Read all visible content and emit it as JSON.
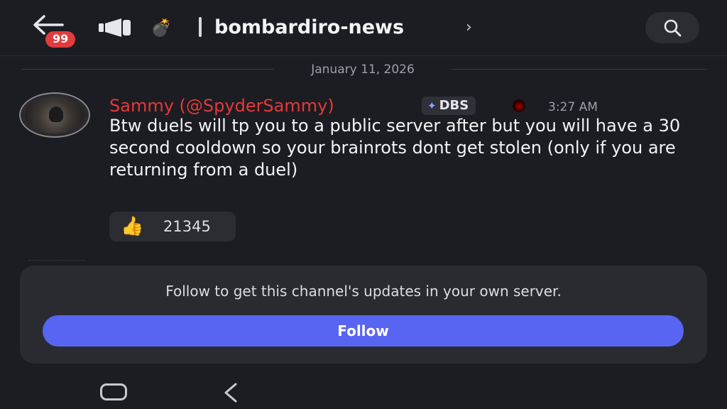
{
  "header": {
    "back_icon": "arrow-left-icon",
    "notification_badge": "99",
    "announcement_icon": "megaphone-icon",
    "channel_emoji": "💣",
    "channel_name": "bombardiro-news",
    "chevron": "›",
    "search_icon": "search-icon"
  },
  "date_divider": "January 11, 2026",
  "message": {
    "author": "Sammy (@SpyderSammy)",
    "author_color": "#e5383b",
    "tag_label": "DBS",
    "tag_icon": "✦",
    "timestamp": "3:27 AM",
    "text": "Btw duels will tp you to a public server after but you will have a 30 second cooldown so your brainrots dont get stolen (only if you are returning from a duel)",
    "reaction": {
      "emoji": "👍",
      "count": "21345"
    }
  },
  "follow_panel": {
    "text": "Follow to get this channel's updates in your own server.",
    "button_label": "Follow",
    "button_color": "#5865f2"
  },
  "system_nav": {
    "home_icon": "rounded-square-icon",
    "back_icon": "chevron-left-icon"
  }
}
